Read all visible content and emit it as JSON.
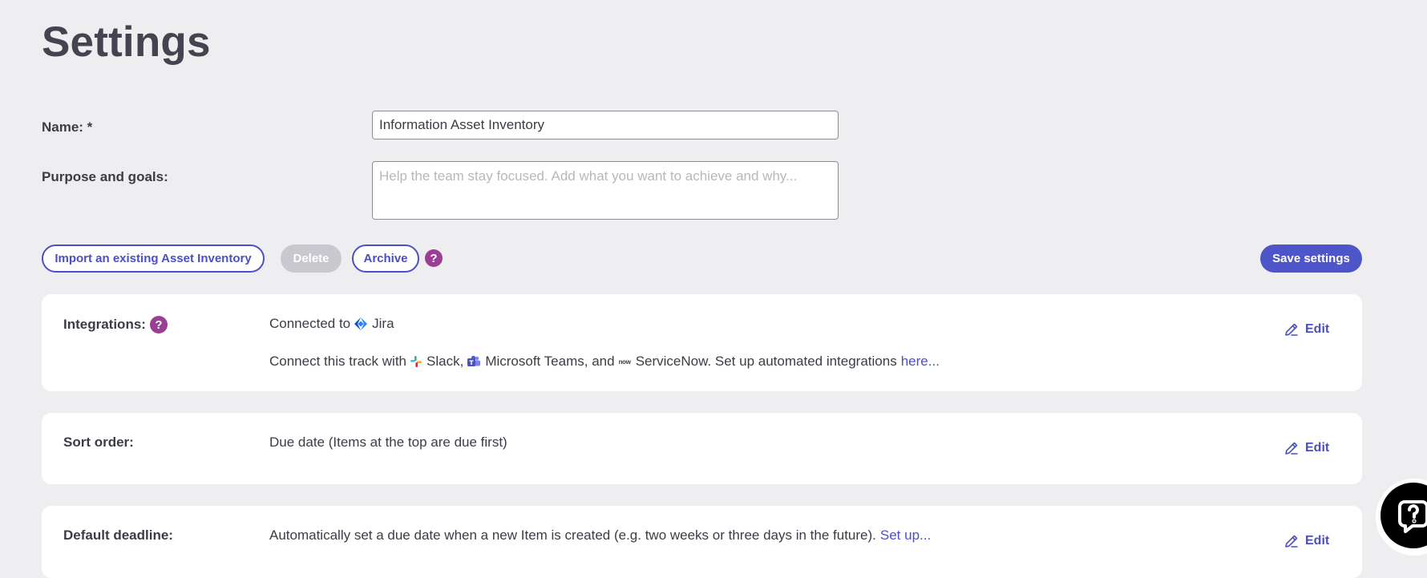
{
  "page": {
    "title": "Settings"
  },
  "form": {
    "name_label": "Name: *",
    "name_value": "Information Asset Inventory",
    "purpose_label": "Purpose and goals:",
    "purpose_placeholder": "Help the team stay focused. Add what you want to achieve and why..."
  },
  "actions": {
    "import_label": "Import an existing Asset Inventory",
    "delete_label": "Delete",
    "archive_label": "Archive",
    "help_symbol": "?",
    "save_label": "Save settings"
  },
  "integrations": {
    "label": "Integrations:",
    "help_symbol": "?",
    "connected_prefix": "Connected to",
    "connected_service": "Jira",
    "connect_prefix": "Connect this track with",
    "slack": "Slack,",
    "teams": "Microsoft Teams, and",
    "now_badge": "now",
    "servicenow": "ServiceNow. Set up automated integrations",
    "here_link": "here...",
    "edit_label": "Edit"
  },
  "sort_order": {
    "label": "Sort order:",
    "value": "Due date (Items at the top are due first)",
    "edit_label": "Edit"
  },
  "default_deadline": {
    "label": "Default deadline:",
    "value": "Automatically set a due date when a new Item is created (e.g. two weeks or three days in the future).",
    "setup_link": "Set up...",
    "edit_label": "Edit"
  },
  "icons": {
    "help": "help-circle-icon",
    "edit": "pencil-icon",
    "jira": "jira-logo-icon",
    "slack": "slack-logo-icon",
    "teams": "microsoft-teams-logo-icon",
    "servicenow": "servicenow-logo-icon",
    "chat": "chat-support-icon"
  },
  "colors": {
    "accent": "#4a4fc4",
    "save_button": "#4e55c8",
    "help_badge": "#9b3f94",
    "disabled_button": "#c9c8ce",
    "background": "#eeeef0"
  }
}
